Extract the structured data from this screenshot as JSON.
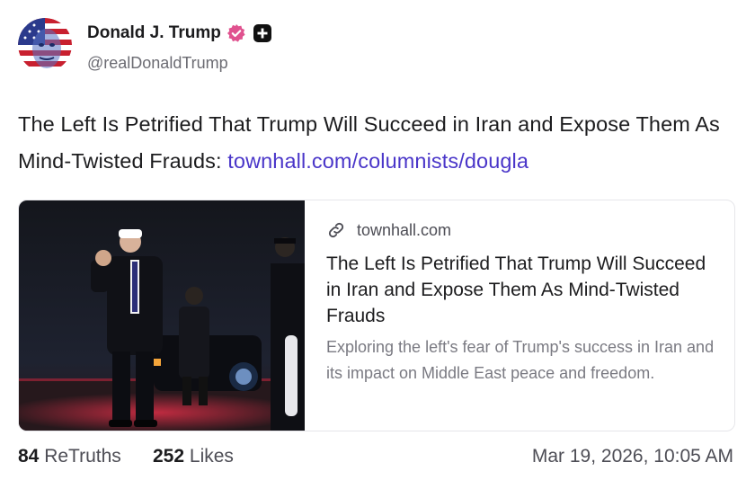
{
  "author": {
    "display_name": "Donald J. Trump",
    "handle": "@realDonaldTrump",
    "verified_icon": "verified-badge-icon",
    "extra_badge_icon": "plus-badge-icon"
  },
  "post": {
    "text": "The Left Is Petrified That Trump Will Succeed in Iran and Expose Them As Mind-Twisted Frauds: ",
    "link_text": "townhall.com/columnists/dougla"
  },
  "link_card": {
    "domain": "townhall.com",
    "title": "The Left Is Petrified That Trump Will Succeed in Iran and Expose Them As Mind-Twisted Frauds",
    "description": "Exploring the left's fear of Trump's success in Iran and its impact on Middle East peace and freedom."
  },
  "stats": {
    "retruths_count": "84",
    "retruths_label": "ReTruths",
    "likes_count": "252",
    "likes_label": "Likes",
    "timestamp": "Mar 19, 2026, 10:05 AM"
  },
  "colors": {
    "link": "#4a36c9",
    "verified": "#e0528f",
    "text": "#1c1c1e",
    "muted": "#7a7a82"
  }
}
